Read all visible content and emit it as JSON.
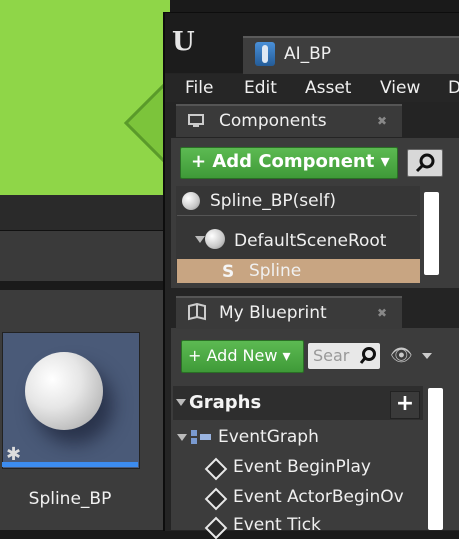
{
  "window": {
    "tab_title": "AI_BP"
  },
  "menu": [
    "File",
    "Edit",
    "Asset",
    "View",
    "D"
  ],
  "components": {
    "panel_title": "Components",
    "add_button": "+ Add Component ▾",
    "items": [
      {
        "label": "Spline_BP(self)"
      },
      {
        "label": "DefaultSceneRoot"
      },
      {
        "label": "Spline"
      }
    ]
  },
  "my_blueprint": {
    "panel_title": "My Blueprint",
    "add_button": "+ Add New ▾",
    "search_placeholder": "Sear",
    "graphs_header": "Graphs",
    "event_graph": "EventGraph",
    "events": [
      "Event BeginPlay",
      "Event ActorBeginOv",
      "Event Tick"
    ]
  },
  "content_browser": {
    "asset_label": "Spline_BP"
  },
  "colors": {
    "accent_green": "#4caf47",
    "selection": "#c8a582",
    "asset_underline": "#3c8cf0"
  }
}
